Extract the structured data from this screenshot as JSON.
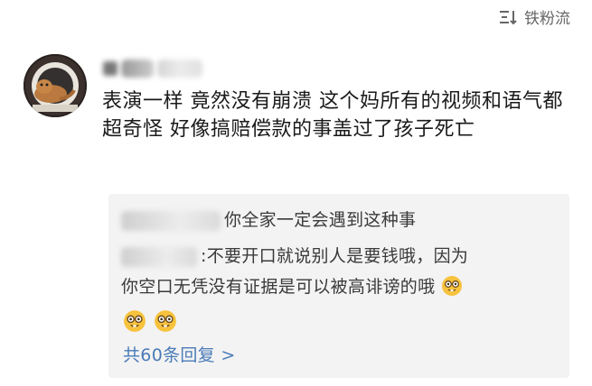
{
  "header": {
    "fans_label": "铁粉流",
    "fans_icon": "fans-list-icon"
  },
  "comment": {
    "avatar": "avatar-cat-photo",
    "text": "表演一样 竟然没有崩溃 这个妈所有的视频和语气都超奇怪 好像搞赔偿款的事盖过了孩子死亡"
  },
  "replies": {
    "items": [
      {
        "text": "你全家一定会遇到这种事"
      },
      {
        "text_line1": ":不要开口就说别人是要钱哦，因为",
        "text_line2": "你空口无凭没有证据是可以被高诽谤的哦"
      }
    ],
    "emoji_icon": "nerd-face-emoji",
    "more_label": "共60条回复 >"
  }
}
